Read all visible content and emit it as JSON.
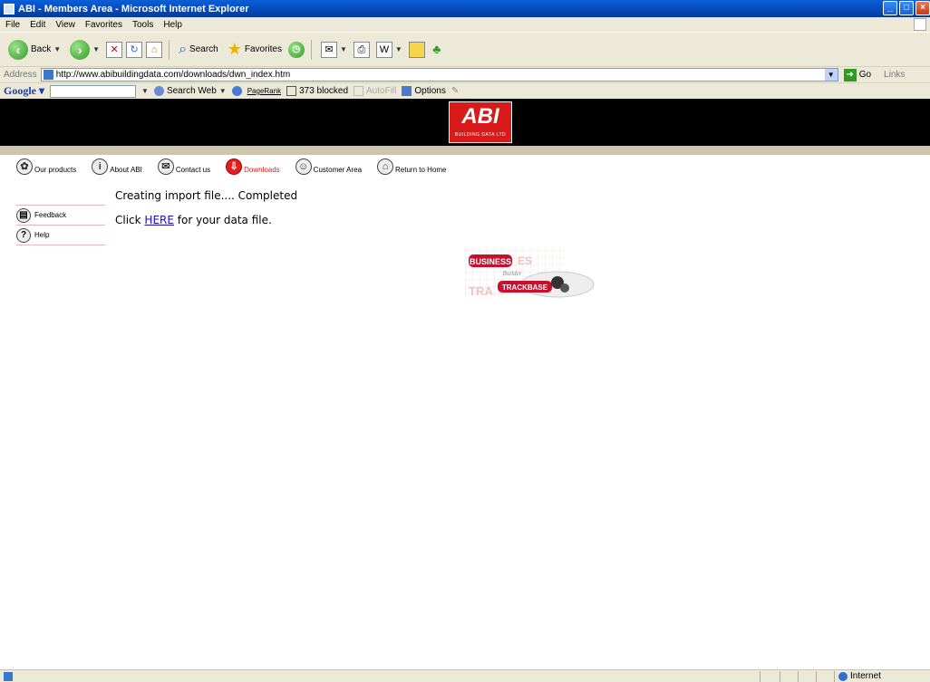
{
  "window": {
    "title": "ABI - Members Area - Microsoft Internet Explorer",
    "controls": [
      "minimize",
      "maximize",
      "close"
    ]
  },
  "menu": [
    "File",
    "Edit",
    "View",
    "Favorites",
    "Tools",
    "Help"
  ],
  "toolbar": {
    "back_label": "Back",
    "search_label": "Search",
    "favorites_label": "Favorites"
  },
  "address": {
    "label": "Address",
    "url": "http://www.abibuildingdata.com/downloads/dwn_index.htm",
    "go_label": "Go",
    "links_label": "Links"
  },
  "google_bar": {
    "logo": "Google",
    "search_web_label": "Search Web",
    "pagerank_label": "PageRank",
    "blocked_label": "373 blocked",
    "autofill_label": "AutoFill",
    "options_label": "Options"
  },
  "site": {
    "logo_text": "ABI",
    "logo_subtext": "BUILDING DATA LTD",
    "nav": [
      {
        "label": "Our products",
        "icon": "products-icon",
        "active": false
      },
      {
        "label": "About ABI",
        "icon": "info-icon",
        "active": false
      },
      {
        "label": "Contact us",
        "icon": "mail-icon",
        "active": false
      },
      {
        "label": "Downloads",
        "icon": "download-icon",
        "active": true
      },
      {
        "label": "Customer Area",
        "icon": "customer-icon",
        "active": false
      },
      {
        "label": "Return to Home",
        "icon": "home-icon",
        "active": false
      }
    ],
    "sidebar": [
      {
        "label": "Feedback",
        "icon": "feedback-icon"
      },
      {
        "label": "Help",
        "icon": "help-icon"
      }
    ]
  },
  "content": {
    "status_line": "Creating import file.... Completed",
    "click_prefix": "Click ",
    "link_text": "HERE",
    "click_suffix": " for your data file."
  },
  "product_logo": {
    "word1": "BUSINESS",
    "word2": "Builder",
    "word3": "TRACKBASE"
  },
  "status_bar": {
    "zone": "Internet"
  },
  "colors": {
    "accent_red": "#e02020",
    "ie_blue": "#0548b8",
    "chrome": "#ece9d8",
    "link": "#1a0dcc"
  }
}
